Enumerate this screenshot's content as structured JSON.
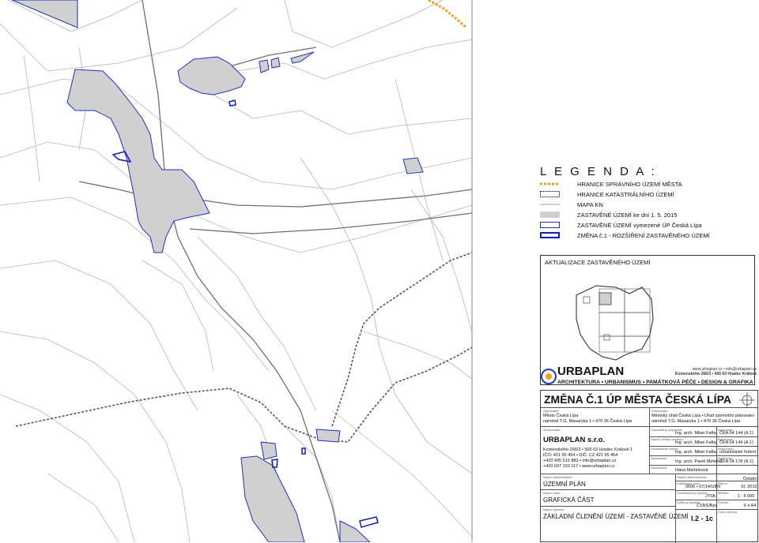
{
  "legend": {
    "title": "L E G E N D A :",
    "items": [
      {
        "id": "boundary-municipal",
        "label": "HRANICE SPRÁVNÍHO ÚZEMÍ MĚSTA",
        "color": "#f0a020"
      },
      {
        "id": "boundary-cadastral",
        "label": "HRANICE KATASTRÁLNÍHO ÚZEMÍ",
        "color": "#333333"
      },
      {
        "id": "map-kn",
        "label": "MAPA KN",
        "color": "#999999"
      },
      {
        "id": "built-area-2015",
        "label": "ZASTAVĚNÉ ÚZEMÍ ke dni 1. 5. 2015",
        "color": "#d0d0d0"
      },
      {
        "id": "built-area-up",
        "label": "ZASTAVĚNÉ ÚZEMÍ vymezené ÚP Česká Lípa",
        "color": "#2030c0"
      },
      {
        "id": "change-expansion",
        "label": "ZMĚNA č.1 -  ROZŠÍŘENÍ ZASTAVĚNÉHO ÚZEMÍ",
        "color": "#1020b0"
      }
    ]
  },
  "update_panel": {
    "title": "AKTUALIZACE ZASTAVĚNÉHO ÚZEMÍ"
  },
  "company_logo": {
    "name": "URBAPLAN",
    "web": "www.urbaplan.cz • info@urbaplan.cz",
    "address": "Komenského 266/3 • 500 03 Hradec Králové",
    "tagline": "ARCHITEKTURA • URBANISMUS • PAMÁTKOVÁ PÉČE • DESIGN & GRAFIKA"
  },
  "title_block": {
    "title": "ZMĚNA Č.1 ÚP MĚSTA ČESKÁ LÍPA",
    "client_label": "Objednatel:",
    "client_name": "Město Česká Lípa",
    "client_address": "náměstí T.G. Masaryka 1 • 470 36 Česká Lípa",
    "acquirer_label": "Pořizovatel:",
    "acquirer_name": "Městský úřad Česká Lípa • Úřad územního plánování",
    "acquirer_address": "náměstí T.G. Masaryka 1 • 470 36 Česká Lípa",
    "processor_label": "Zpracovatel:",
    "processor_name": "URBAPLAN s.r.o.",
    "processor_lines": [
      "Komenského 266/3 • 500 03 Hradec Králové 1",
      "IČO: 421 95 454 • DIČ: CZ 421 95 454",
      "+420 495 515 883 • info@urbaplan.cz",
      "+420 607 193 117 • www.urbaplan.cz"
    ],
    "team": [
      {
        "role": "Odpovědný projektant:",
        "name": "Ing. arch. Milan Fafta",
        "auth_label": "Autorizace:",
        "auth": "ČKA 04 144 (A.1)"
      },
      {
        "role": "Hlavní inženýr projektu:",
        "name": "Ing. arch. Milan Fafta",
        "auth_label": "Autorizace:",
        "auth": "ČKA 04 144 (A.1)"
      },
      {
        "role": "Urbanistické řešení:",
        "name": "Ing. arch. Milan Fafta",
        "auth_label": "Autorizace:",
        "auth": "urbanistické řešení"
      },
      {
        "role": "Spolupráce:",
        "name": "Ing. arch. Pavel Metelka",
        "auth_label": "Autorizace:",
        "auth": "ČKA 04 178 (A.1)"
      },
      {
        "role": "Spolupráce:",
        "name": "Hana Martinková",
        "auth_label": "",
        "auth": ""
      }
    ],
    "doc_label": "Název dokumentace:",
    "doc": "ÚZEMNÍ PLÁN",
    "part_label": "Název části:",
    "part": "GRAFICKÁ ČÁST",
    "sheet_label": "Název výkresu:",
    "sheet": "ZÁKLADNÍ ČLENĚNÍ ÚZEMÍ - ZASTAVĚNÉ ÚZEMÍ",
    "stage_label": "Stupeň dokumentace:",
    "stage": "Ostatní",
    "code_label": "Zakázkové číslo:",
    "code": "0506 • 07/14/UBN",
    "date_label": "Datum:",
    "date": "XI. 2015",
    "coord_label": "Souřadnicový systém:",
    "coord": "JTSK",
    "scale_label": "Měřítko:",
    "scale": "1 : 5 000",
    "height_label": "Výškový systém:",
    "height": "ČSNS/Bpv",
    "format_label": "Formát:",
    "format": "6 x A4",
    "drawing_label": "Číslo výkresu:",
    "drawing_no": "I.2 - 1c"
  }
}
